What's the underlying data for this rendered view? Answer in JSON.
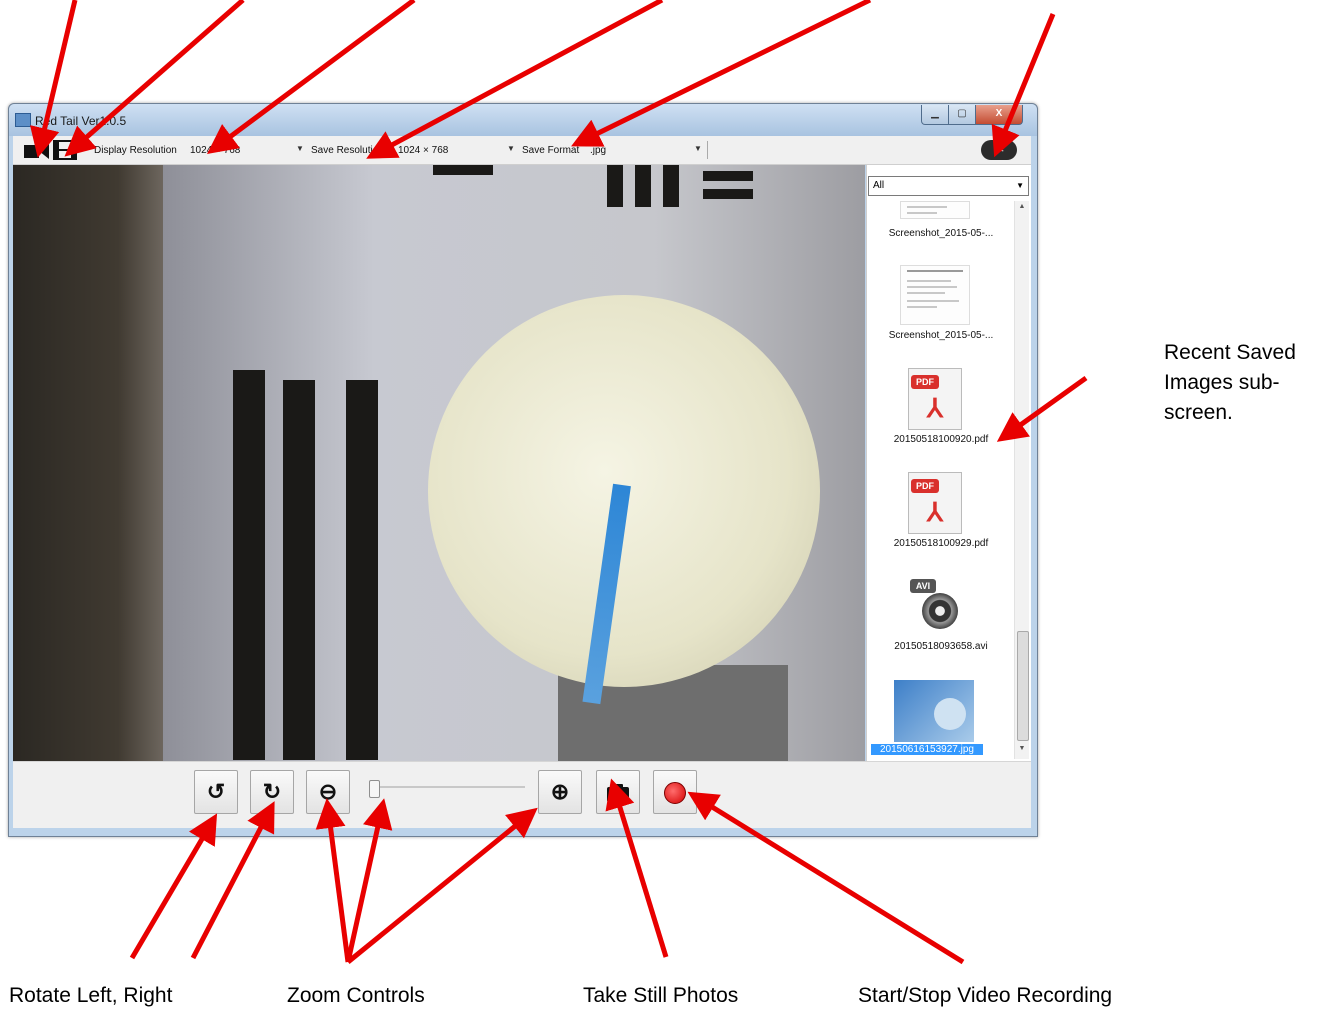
{
  "window": {
    "title": "Red Tail Ver1.0.5",
    "min_glyph": "▁",
    "max_glyph": "▢",
    "close_glyph": "X"
  },
  "toolbar": {
    "display_resolution_label": "Display Resolution",
    "display_resolution_value": "1024 × 768",
    "save_resolution_label": "Save Resolution",
    "save_resolution_value": "1024 × 768",
    "save_format_label": "Save Format",
    "save_format_value": ".jpg",
    "dropdown_arrow": "▼",
    "camera_icon": "video-camera-icon",
    "film_icon": "film-strip-icon",
    "settings_icon": "tools-icon",
    "settings_glyph": "✂"
  },
  "side_panel": {
    "filter_value": "All",
    "filter_arrow": "▼",
    "scroll_up": "▲",
    "scroll_down": "▼",
    "items": [
      {
        "label": "Screenshot_2015-05-...",
        "type": "screenshot"
      },
      {
        "label": "Screenshot_2015-05-...",
        "type": "screenshot"
      },
      {
        "label": "20150518100920.pdf",
        "type": "pdf",
        "tag": "PDF"
      },
      {
        "label": "20150518100929.pdf",
        "type": "pdf",
        "tag": "PDF"
      },
      {
        "label": "20150518093658.avi",
        "type": "avi",
        "tag": "AVI"
      },
      {
        "label": "20150616153927.jpg",
        "type": "jpg",
        "selected": true
      }
    ]
  },
  "controls": {
    "rotate_left_glyph": "↺",
    "rotate_right_glyph": "↻",
    "zoom_out_glyph": "⊖",
    "zoom_in_glyph": "⊕",
    "camera_glyph": "📷",
    "zoom_level": 0
  },
  "annotations": {
    "recent_saved": [
      "Recent Saved",
      "Images sub-",
      "screen."
    ],
    "rotate": "Rotate Left, Right",
    "zoom": "Zoom Controls",
    "still": "Take Still Photos",
    "record": "Start/Stop Video Recording"
  },
  "colors": {
    "arrow": "#e80000",
    "record": "#d40000",
    "selection": "#3399ff"
  }
}
